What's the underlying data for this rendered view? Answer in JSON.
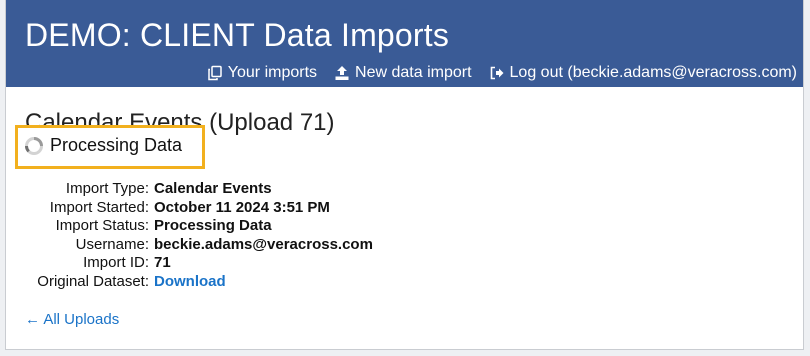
{
  "header": {
    "title": "DEMO: CLIENT Data Imports",
    "nav": {
      "your_imports": "Your imports",
      "new_data_import": "New data import",
      "log_out": "Log out (beckie.adams@veracross.com)"
    }
  },
  "main": {
    "heading": "Calendar Events (Upload 71)",
    "status": "Processing Data",
    "details": [
      {
        "label": "Import Type:",
        "value": "Calendar Events"
      },
      {
        "label": "Import Started:",
        "value": "October 11 2024 3:51 PM"
      },
      {
        "label": "Import Status:",
        "value": "Processing Data"
      },
      {
        "label": "Username:",
        "value": "beckie.adams@veracross.com"
      },
      {
        "label": "Import ID:",
        "value": "71"
      },
      {
        "label": "Original Dataset:",
        "value": "Download"
      }
    ],
    "back_link": "← All Uploads"
  },
  "colors": {
    "header_bg": "#3a5b96",
    "link": "#1a73c8",
    "highlight": "#f2b01e"
  },
  "icons": [
    "copy-icon",
    "upload-icon",
    "sign-out-icon",
    "loading-spinner-icon"
  ]
}
